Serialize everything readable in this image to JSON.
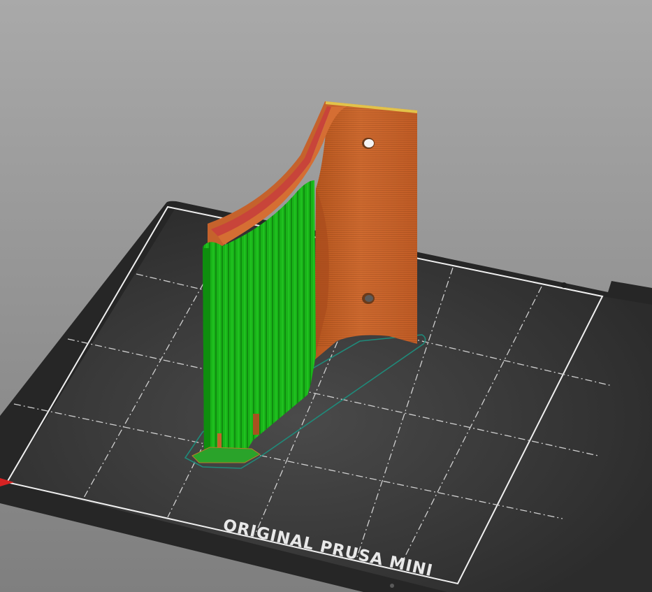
{
  "view": {
    "kind": "3D print preview",
    "background_top": "#a9a9a9",
    "background_bottom": "#7f7f7f"
  },
  "bed": {
    "label": "ORIGINAL PRUSA MINI",
    "surface_color": "#3a3a3a",
    "edge_color": "#262626",
    "border_color": "#f0f0f0",
    "grid_color": "#cfcfcf",
    "grid_divisions": 6
  },
  "model": {
    "perimeter_color": "#c5622c",
    "support_color": "#19b419",
    "top_solid_color": "#c8443a",
    "edge_highlight_color": "#e2c24a",
    "skirt_color": "#1f8a7a",
    "icons": [
      "mounting-hole-icon",
      "mounting-hole-icon"
    ]
  }
}
